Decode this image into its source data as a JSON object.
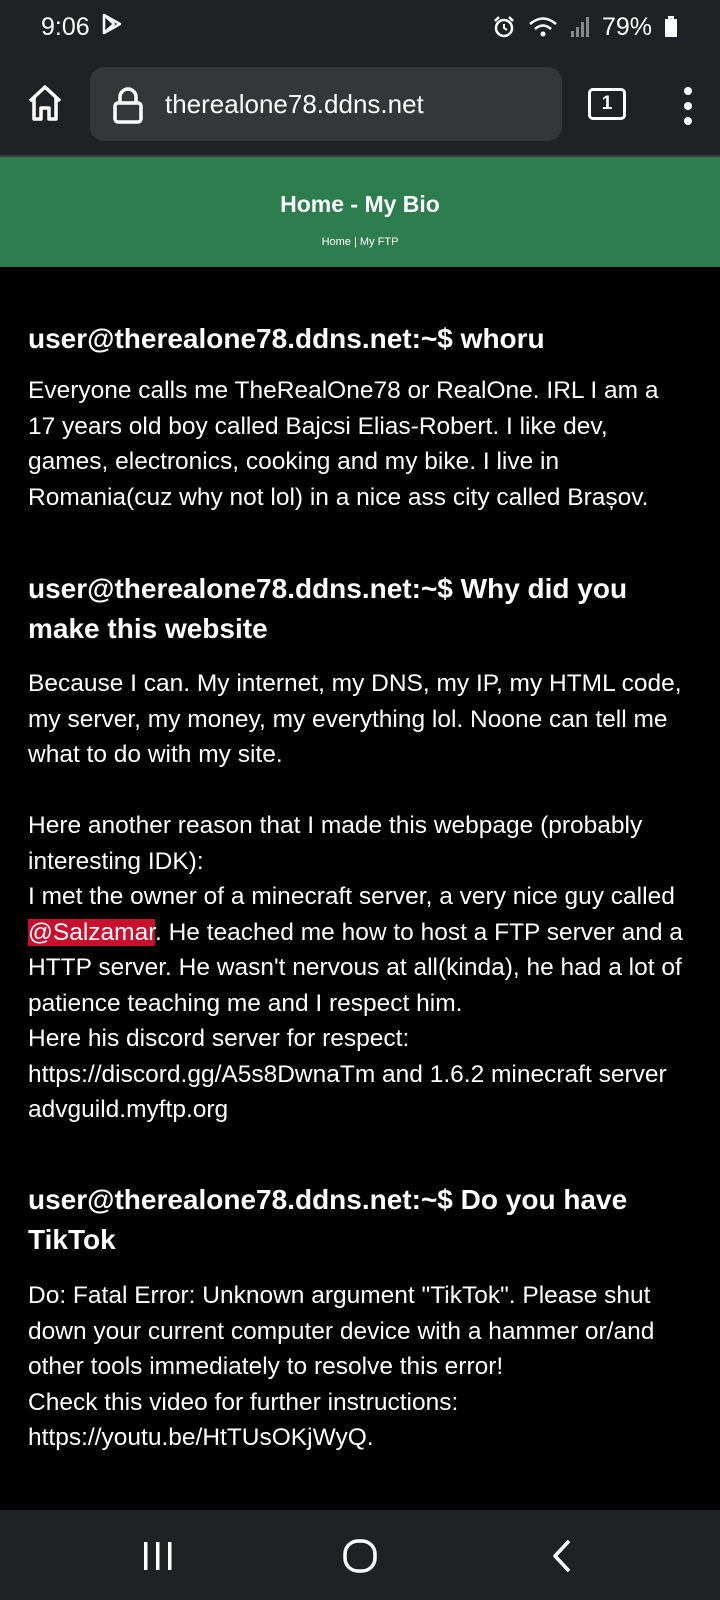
{
  "status_bar": {
    "time": "9:06",
    "battery": "79%",
    "icons": [
      "play-store-icon",
      "alarm-icon",
      "wifi-icon",
      "signal-icon",
      "battery-icon"
    ]
  },
  "browser": {
    "url": "therealone78.ddns.net",
    "tab_count": "1",
    "icons": [
      "home-icon",
      "lock-icon",
      "tabs-icon",
      "more-vert-icon"
    ]
  },
  "site": {
    "title": "Home - My Bio",
    "nav": {
      "home": "Home",
      "separator": " | ",
      "ftp": "My FTP"
    },
    "header_color": "#2e7d4f"
  },
  "sections": [
    {
      "heading": "user@therealone78.ddns.net:~$ whoru",
      "body": "Everyone calls me TheRealOne78 or RealOne. IRL I am a 17 years old boy called Bajcsi Elias-Robert. I like dev, games, electronics, cooking and my bike. I live in Romania(cuz why not lol) in a nice ass city called Brașov."
    },
    {
      "heading": "user@therealone78.ddns.net:~$ Why did you make this website",
      "body_part1": "Because I can. My internet, my DNS, my IP, my HTML code, my server, my money, my everything lol. Noone can tell me what to do with my site.",
      "body_part2": "Here another reason that I made this webpage (probably interesting IDK):",
      "body_part3_pre": "I met the owner of a minecraft server, a very nice guy called ",
      "mention": "@Salzamar",
      "body_part3_post": ". He teached me how to host a FTP server and a HTTP server. He wasn't nervous at all(kinda), he had a lot of patience teaching me and I respect him.",
      "body_part4": "Here his discord server for respect: https://discord.gg/A5s8DwnaTm and 1.6.2 minecraft server advguild.myftp.org",
      "mention_color": "#c8102e"
    },
    {
      "heading": "user@therealone78.ddns.net:~$ Do you have TikTok",
      "body_part1": "Do: Fatal Error: Unknown argument \"TikTok\". Please shut down your current computer device with a hammer or/and other tools immediately to resolve this error!",
      "body_part2": "Check this video for further instructions: https://youtu.be/HtTUsOKjWyQ."
    }
  ],
  "nav_bar": {
    "icons": [
      "recent-apps-icon",
      "home-circle-icon",
      "back-icon"
    ]
  }
}
